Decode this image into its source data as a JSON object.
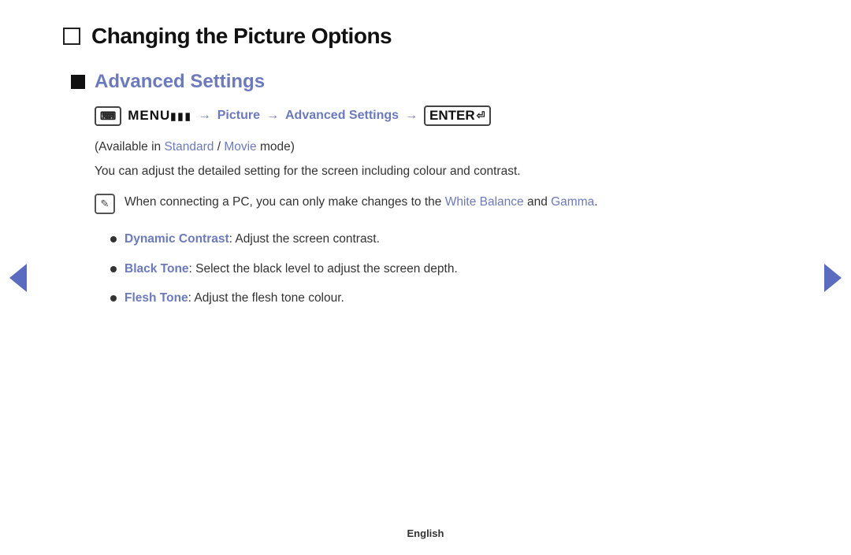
{
  "page": {
    "title": "Changing the Picture Options",
    "language": "English"
  },
  "section": {
    "title": "Advanced Settings",
    "menu_icon_label": "m",
    "menu_label": "MENU",
    "menu_bars": "III",
    "arrow1": "→",
    "path_picture": "Picture",
    "arrow2": "→",
    "path_advanced": "Advanced Settings",
    "arrow3": "→",
    "enter_label": "ENTER",
    "available_text_prefix": "(Available in ",
    "available_standard": "Standard",
    "available_slash": " / ",
    "available_movie": "Movie",
    "available_suffix": " mode)",
    "description": "You can adjust the detailed setting for the screen including colour and contrast.",
    "note_text_prefix": "When connecting a PC, you can only make changes to the ",
    "note_white_balance": "White Balance",
    "note_and": " and ",
    "note_gamma": "Gamma",
    "note_period": ".",
    "bullets": [
      {
        "label": "Dynamic Contrast",
        "text": ": Adjust the screen contrast."
      },
      {
        "label": "Black Tone",
        "text": ": Select the black level to adjust the screen depth."
      },
      {
        "label": "Flesh Tone",
        "text": ": Adjust the flesh tone colour."
      }
    ]
  },
  "nav": {
    "left_label": "previous",
    "right_label": "next"
  }
}
